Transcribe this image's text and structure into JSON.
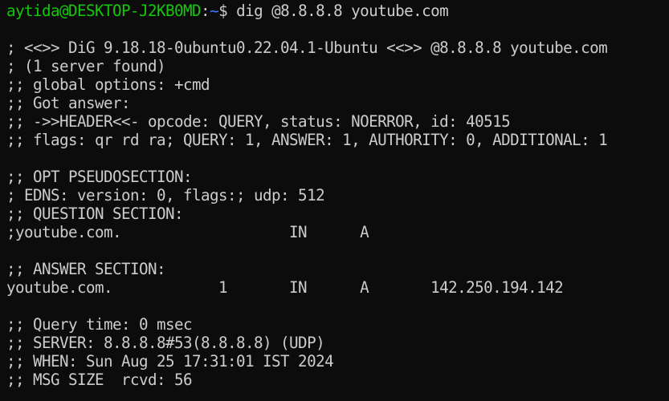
{
  "terminal": {
    "prompt": {
      "user_host": "aytida@DESKTOP-J2KB0MD",
      "separator": ":",
      "path": "~",
      "symbol": "$ ",
      "command": "dig @8.8.8.8 youtube.com"
    },
    "colors": {
      "background": "#0c0c0c",
      "foreground": "#cccccc",
      "user_host": "#16c60c",
      "path": "#3b78ff"
    },
    "lines": [
      "",
      "; <<>> DiG 9.18.18-0ubuntu0.22.04.1-Ubuntu <<>> @8.8.8.8 youtube.com",
      "; (1 server found)",
      ";; global options: +cmd",
      ";; Got answer:",
      ";; ->>HEADER<<- opcode: QUERY, status: NOERROR, id: 40515",
      ";; flags: qr rd ra; QUERY: 1, ANSWER: 1, AUTHORITY: 0, ADDITIONAL: 1",
      "",
      ";; OPT PSEUDOSECTION:",
      "; EDNS: version: 0, flags:; udp: 512",
      ";; QUESTION SECTION:",
      ";youtube.com.                   IN      A",
      "",
      ";; ANSWER SECTION:",
      "youtube.com.            1       IN      A       142.250.194.142",
      "",
      ";; Query time: 0 msec",
      ";; SERVER: 8.8.8.8#53(8.8.8.8) (UDP)",
      ";; WHEN: Sun Aug 25 17:31:01 IST 2024",
      ";; MSG SIZE  rcvd: 56"
    ]
  }
}
